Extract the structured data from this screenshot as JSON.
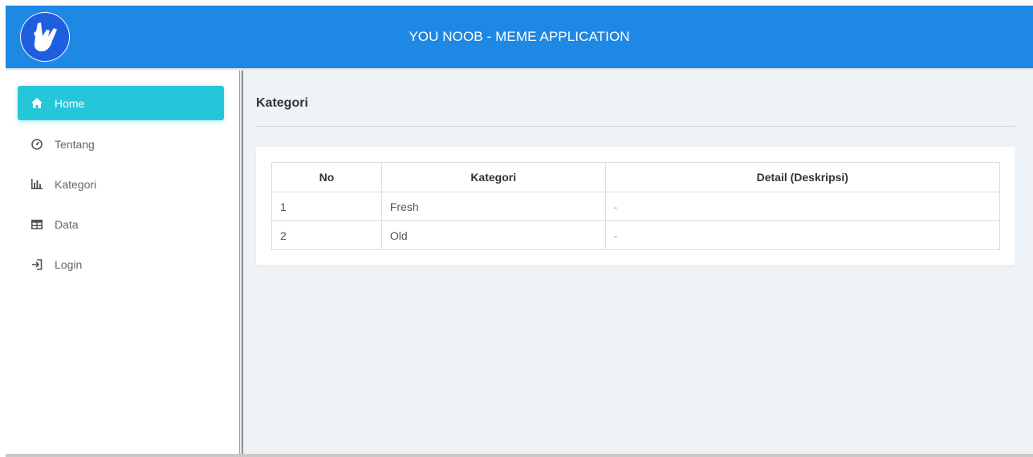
{
  "header": {
    "title": "YOU NOOB - MEME APPLICATION",
    "logo_icon": "rock-hand-icon",
    "background": "#1e88e5"
  },
  "sidebar": {
    "items": [
      {
        "label": "Home",
        "icon": "home-icon",
        "active": true
      },
      {
        "label": "Tentang",
        "icon": "gauge-icon",
        "active": false
      },
      {
        "label": "Kategori",
        "icon": "bar-chart-icon",
        "active": false
      },
      {
        "label": "Data",
        "icon": "table-icon",
        "active": false
      },
      {
        "label": "Login",
        "icon": "login-icon",
        "active": false
      }
    ],
    "active_color": "#26c6da"
  },
  "main": {
    "title": "Kategori",
    "table": {
      "headers": [
        "No",
        "Kategori",
        "Detail (Deskripsi)"
      ],
      "rows": [
        [
          "1",
          "Fresh",
          "-"
        ],
        [
          "2",
          "Old",
          "-"
        ]
      ]
    }
  }
}
